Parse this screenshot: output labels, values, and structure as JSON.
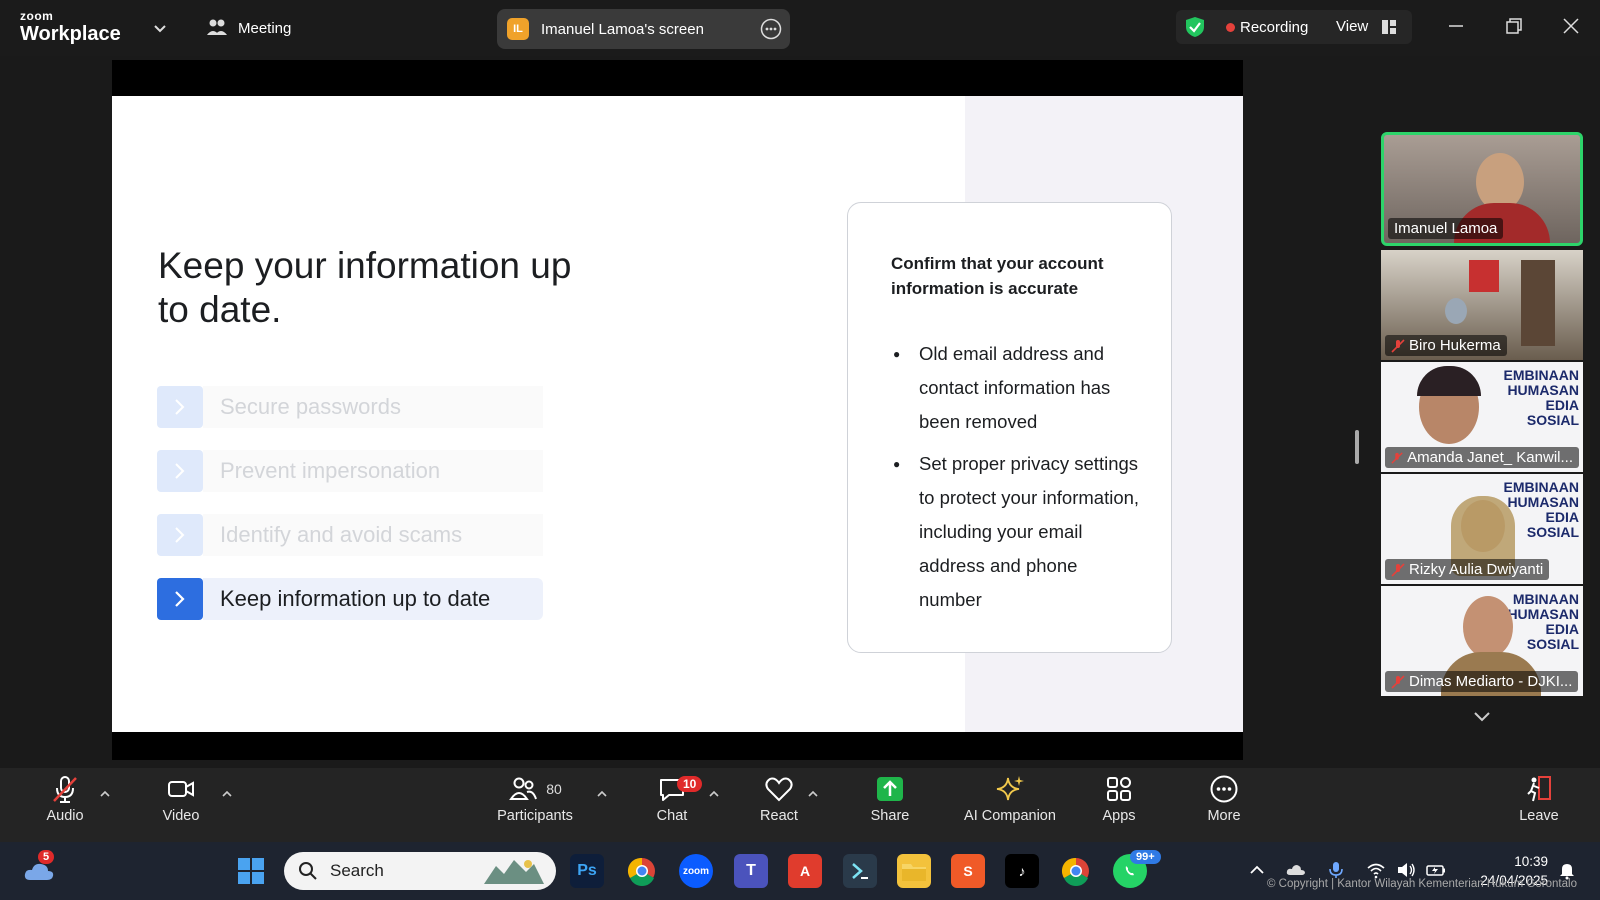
{
  "app": {
    "brand_small": "zoom",
    "brand_big": "Workplace",
    "meeting_label": "Meeting"
  },
  "share": {
    "initials": "IL",
    "title": "Imanuel Lamoa's screen"
  },
  "status": {
    "recording_label": "Recording",
    "view_label": "View"
  },
  "slide": {
    "heading": "Keep your information up to date.",
    "menu": [
      {
        "label": "Secure passwords",
        "active": false
      },
      {
        "label": "Prevent impersonation",
        "active": false
      },
      {
        "label": "Identify and avoid scams",
        "active": false
      },
      {
        "label": "Keep information up to date",
        "active": true
      }
    ],
    "card": {
      "title": "Confirm that your account information is accurate",
      "bullets": [
        "Old email address and contact information has been removed",
        "Set proper privacy settings to protect your information, including your email address and phone number"
      ]
    }
  },
  "participants": [
    {
      "name": "Imanuel Lamoa",
      "speaking": true,
      "muted": false
    },
    {
      "name": "Biro Hukerma",
      "speaking": false,
      "muted": true
    },
    {
      "name": "Amanda Janet_ Kanwil...",
      "speaking": false,
      "muted": true,
      "banner": "EMBINAAN HUMASAN EDIA SOSIAL"
    },
    {
      "name": "Rizky Aulia Dwiyanti",
      "speaking": false,
      "muted": true,
      "banner": "EMBINAAN HUMASAN EDIA SOSIAL"
    },
    {
      "name": "Dimas Mediarto - DJKI...",
      "speaking": false,
      "muted": true,
      "banner": "MBINAAN HUMASAN EDIA SOSIAL"
    }
  ],
  "toolbar": {
    "audio": "Audio",
    "video": "Video",
    "participants": "Participants",
    "participants_count": "80",
    "chat": "Chat",
    "chat_badge": "10",
    "react": "React",
    "share": "Share",
    "ai": "AI Companion",
    "apps": "Apps",
    "more": "More",
    "leave": "Leave"
  },
  "taskbar": {
    "weather_badge": "5",
    "search_placeholder": "Search",
    "whatsapp_badge": "99+",
    "time": "10:39",
    "date": "24/04/2025",
    "copyright": "© Copyright | Kantor Wilayah Kementerian Hukum Gorontalo"
  },
  "colors": {
    "accent_blue": "#2d6ee0",
    "speaking_green": "#2dd46a",
    "record_red": "#e5413b",
    "share_green": "#1fb54a"
  }
}
